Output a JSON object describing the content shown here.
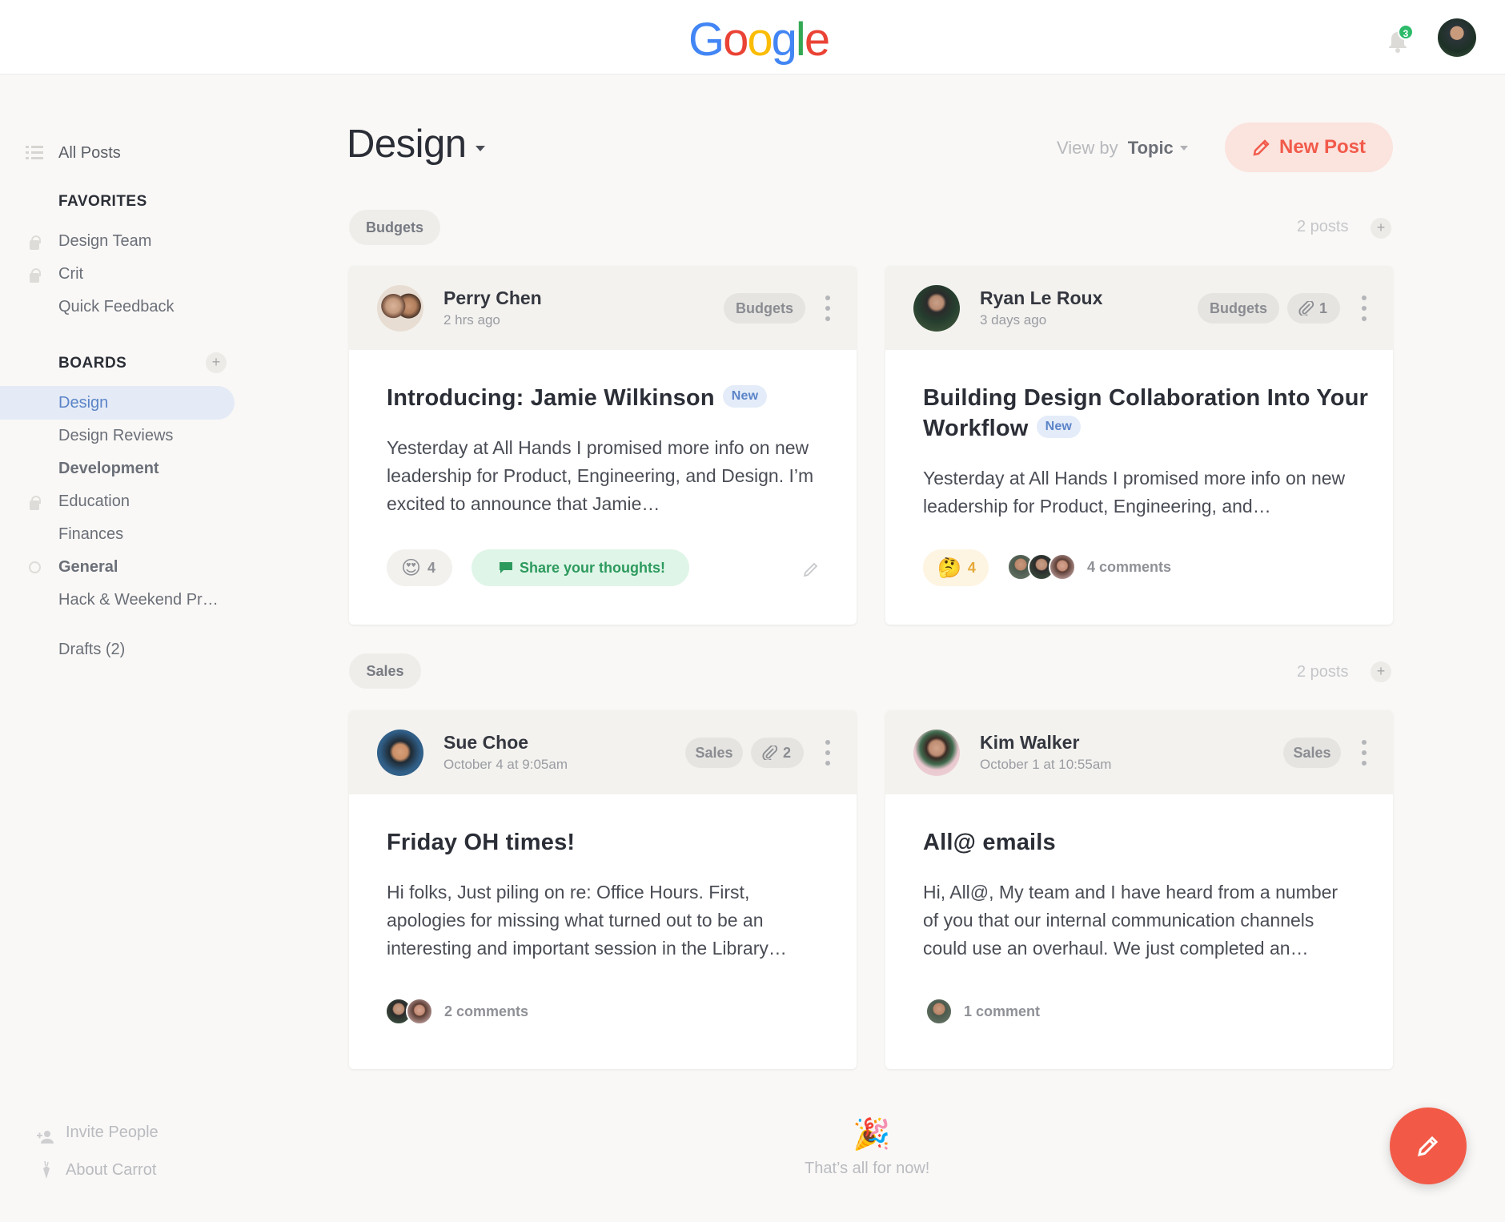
{
  "header": {
    "logo_letters": [
      "G",
      "o",
      "o",
      "g",
      "l",
      "e"
    ],
    "logo_colors": [
      "#4285f4",
      "#ea4335",
      "#fbbc05",
      "#4285f4",
      "#34a853",
      "#ea4335"
    ],
    "notification_count": "3"
  },
  "sidebar": {
    "all_posts": "All Posts",
    "favorites_heading": "FAVORITES",
    "favorites": [
      "Design Team",
      "Crit",
      "Quick Feedback"
    ],
    "boards_heading": "BOARDS",
    "boards": [
      "Design",
      "Design Reviews",
      "Development",
      "Education",
      "Finances",
      "General",
      "Hack & Weekend Pr…"
    ],
    "drafts": "Drafts (2)",
    "invite": "Invite People",
    "about": "About Carrot"
  },
  "main": {
    "title": "Design",
    "view_by_label": "View by",
    "view_by_value": "Topic",
    "new_post": "New Post",
    "sections": [
      {
        "topic": "Budgets",
        "count": "2 posts",
        "posts": [
          {
            "author": "Perry Chen",
            "time": "2 hrs ago",
            "tag": "Budgets",
            "title": "Introducing: Jamie Wilkinson",
            "new_badge": "New",
            "body": "Yesterday at All Hands I promised more info on new leadership for Product, Engineering, and Design. I’m excited to announce that Jamie…",
            "reaction_emoji": "😍",
            "reaction_count": "4",
            "share": "Share your thoughts!"
          },
          {
            "author": "Ryan Le Roux",
            "time": "3 days ago",
            "tag": "Budgets",
            "attachments": "1",
            "title": "Building Design Collaboration Into Your Workflow",
            "new_badge": "New",
            "body": "Yesterday at All Hands I promised more info on new leadership for Product, Engineering, and…",
            "reaction_emoji": "🤔",
            "reaction_count": "4",
            "comments": "4 comments"
          }
        ]
      },
      {
        "topic": "Sales",
        "count": "2 posts",
        "posts": [
          {
            "author": "Sue Choe",
            "time": "October 4 at 9:05am",
            "tag": "Sales",
            "attachments": "2",
            "title": "Friday OH times!",
            "body": "Hi folks, Just piling on re: Office Hours. First, apologies for missing what turned out to be an interesting and important session in the Library…",
            "comments": "2 comments"
          },
          {
            "author": "Kim Walker",
            "time": "October 1 at 10:55am",
            "tag": "Sales",
            "title": "All@ emails",
            "body": "Hi, All@, My team and I have heard from a number of you that our internal communication channels could use an overhaul. We just completed an…",
            "comments": "1 comment"
          }
        ]
      }
    ],
    "end_emoji": "🎉",
    "end_text": "That’s all for now!"
  }
}
